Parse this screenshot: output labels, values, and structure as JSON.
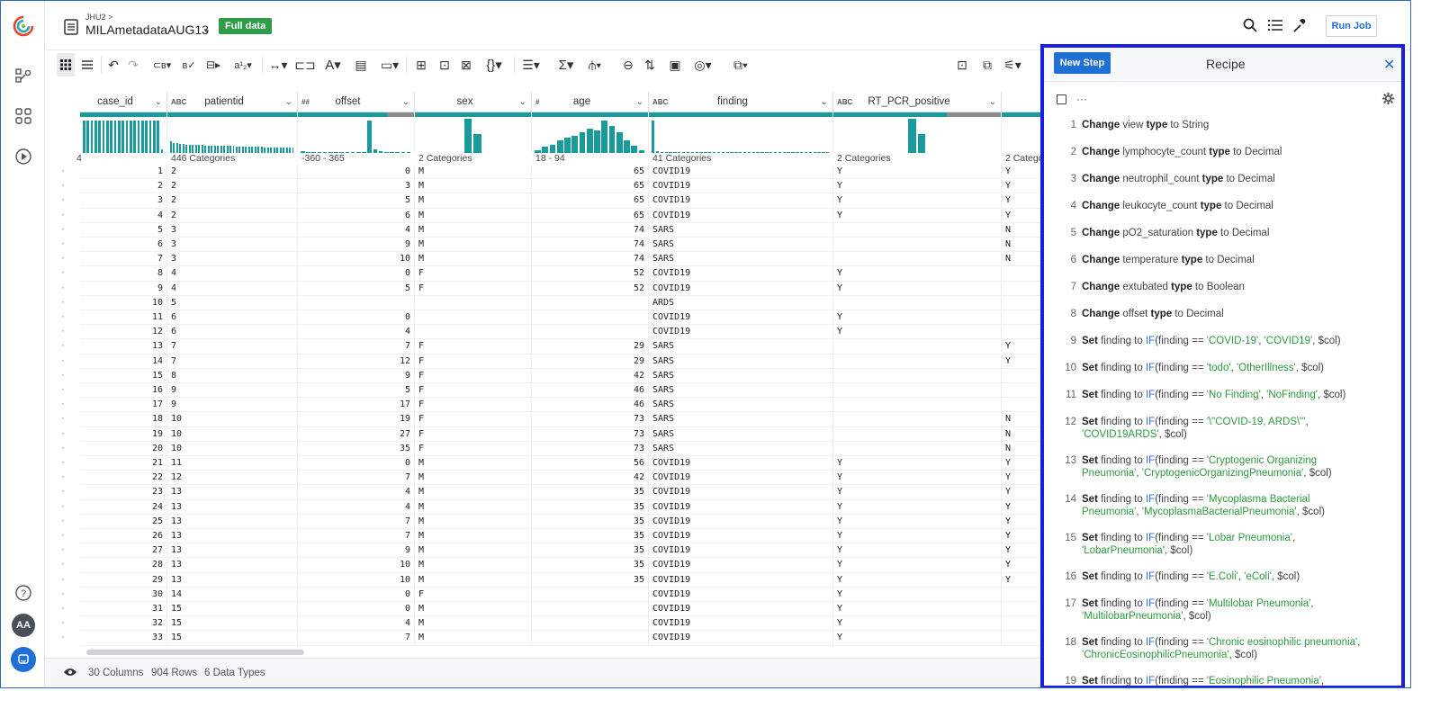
{
  "header": {
    "breadcrumb": "JHU2 >",
    "dataset_name": "MILAmetadataAUG13",
    "full_data_badge": "Full data",
    "run_job_label": "Run Job"
  },
  "colors": {
    "accent": "#1a9a9a",
    "badge": "#2e9d4a",
    "primary": "#1f6fd4",
    "recipe_border": "#1a1ee0"
  },
  "nav": {
    "icons": [
      "logo-icon",
      "flow-icon",
      "library-icon",
      "jobs-icon",
      "help-icon",
      "avatar",
      "chat-icon"
    ],
    "avatar_initials": "AA"
  },
  "toolbar": {
    "icons": [
      "grid-view-icon",
      "list-view-icon",
      "undo-icon",
      "redo-icon",
      "change-type-icon",
      "validate-icon",
      "split-icon",
      "rename-icon",
      "move-column-icon",
      "merge-icon",
      "text-format-icon",
      "extract-icon",
      "restructure-icon",
      "nest-icon",
      "unnest-icon",
      "replace-icon",
      "function-icon",
      "filter-icon",
      "aggregate-icon",
      "pivot-icon",
      "join-icon",
      "sort-icon",
      "comment-icon",
      "target-icon",
      "copy-icon",
      "columns-icon",
      "details-icon",
      "settings-icon"
    ]
  },
  "columns": [
    {
      "name": "case_id",
      "type_label": "",
      "summary": "4"
    },
    {
      "name": "patientid",
      "type_label": "ABC",
      "summary": "446 Categories"
    },
    {
      "name": "offset",
      "type_label": "##",
      "summary": "-360 - 365"
    },
    {
      "name": "sex",
      "type_label": "",
      "summary": "2 Categories"
    },
    {
      "name": "age",
      "type_label": "#",
      "summary": "18 - 94"
    },
    {
      "name": "finding",
      "type_label": "ABC",
      "summary": "41 Categories"
    },
    {
      "name": "RT_PCR_positive",
      "type_label": "ABC",
      "summary": "2 Categories"
    },
    {
      "name": "",
      "type_label": "",
      "summary": "2 Catego"
    }
  ],
  "rows": [
    [
      "1",
      "2",
      "0",
      "M",
      "65",
      "COVID19",
      "Y",
      "Y"
    ],
    [
      "2",
      "2",
      "3",
      "M",
      "65",
      "COVID19",
      "Y",
      "Y"
    ],
    [
      "3",
      "2",
      "5",
      "M",
      "65",
      "COVID19",
      "Y",
      "Y"
    ],
    [
      "4",
      "2",
      "6",
      "M",
      "65",
      "COVID19",
      "Y",
      "Y"
    ],
    [
      "5",
      "3",
      "4",
      "M",
      "74",
      "SARS",
      "",
      "N"
    ],
    [
      "6",
      "3",
      "9",
      "M",
      "74",
      "SARS",
      "",
      "N"
    ],
    [
      "7",
      "3",
      "10",
      "M",
      "74",
      "SARS",
      "",
      "N"
    ],
    [
      "8",
      "4",
      "0",
      "F",
      "52",
      "COVID19",
      "Y",
      ""
    ],
    [
      "9",
      "4",
      "5",
      "F",
      "52",
      "COVID19",
      "Y",
      ""
    ],
    [
      "10",
      "5",
      "",
      "",
      "",
      "ARDS",
      "",
      ""
    ],
    [
      "11",
      "6",
      "0",
      "",
      "",
      "COVID19",
      "Y",
      ""
    ],
    [
      "12",
      "6",
      "4",
      "",
      "",
      "COVID19",
      "Y",
      ""
    ],
    [
      "13",
      "7",
      "7",
      "F",
      "29",
      "SARS",
      "",
      "Y"
    ],
    [
      "14",
      "7",
      "12",
      "F",
      "29",
      "SARS",
      "",
      "Y"
    ],
    [
      "15",
      "8",
      "9",
      "F",
      "42",
      "SARS",
      "",
      ""
    ],
    [
      "16",
      "9",
      "5",
      "F",
      "46",
      "SARS",
      "",
      ""
    ],
    [
      "17",
      "9",
      "17",
      "F",
      "46",
      "SARS",
      "",
      ""
    ],
    [
      "18",
      "10",
      "19",
      "F",
      "73",
      "SARS",
      "",
      "N"
    ],
    [
      "19",
      "10",
      "27",
      "F",
      "73",
      "SARS",
      "",
      "N"
    ],
    [
      "20",
      "10",
      "35",
      "F",
      "73",
      "SARS",
      "",
      "N"
    ],
    [
      "21",
      "11",
      "0",
      "M",
      "56",
      "COVID19",
      "Y",
      "Y"
    ],
    [
      "22",
      "12",
      "7",
      "M",
      "42",
      "COVID19",
      "Y",
      "Y"
    ],
    [
      "23",
      "13",
      "4",
      "M",
      "35",
      "COVID19",
      "Y",
      "Y"
    ],
    [
      "24",
      "13",
      "4",
      "M",
      "35",
      "COVID19",
      "Y",
      "Y"
    ],
    [
      "25",
      "13",
      "7",
      "M",
      "35",
      "COVID19",
      "Y",
      "Y"
    ],
    [
      "26",
      "13",
      "7",
      "M",
      "35",
      "COVID19",
      "Y",
      "Y"
    ],
    [
      "27",
      "13",
      "9",
      "M",
      "35",
      "COVID19",
      "Y",
      "Y"
    ],
    [
      "28",
      "13",
      "10",
      "M",
      "35",
      "COVID19",
      "Y",
      "Y"
    ],
    [
      "29",
      "13",
      "10",
      "M",
      "35",
      "COVID19",
      "Y",
      "Y"
    ],
    [
      "30",
      "14",
      "0",
      "F",
      "",
      "COVID19",
      "Y",
      ""
    ],
    [
      "31",
      "15",
      "0",
      "M",
      "",
      "COVID19",
      "Y",
      ""
    ],
    [
      "32",
      "15",
      "4",
      "M",
      "",
      "COVID19",
      "Y",
      ""
    ],
    [
      "33",
      "15",
      "7",
      "M",
      "",
      "COVID19",
      "Y",
      ""
    ]
  ],
  "histograms": {
    "case_id": [
      0.95,
      0.95,
      0.95,
      0.95,
      0.95,
      0.95,
      0.95,
      0.95,
      0.95,
      0.95,
      0.95,
      0.95,
      0.95,
      0.95,
      0.95,
      0.95,
      0.95,
      0.95,
      0.95,
      0.95,
      0.1
    ],
    "patientid": [
      0.35,
      0.3,
      0.28,
      0.27,
      0.26,
      0.25,
      0.25,
      0.24,
      0.24,
      0.23,
      0.23,
      0.22,
      0.22,
      0.22,
      0.21,
      0.21,
      0.21,
      0.2,
      0.2,
      0.2,
      0.2,
      0.19,
      0.19,
      0.19,
      0.19,
      0.18,
      0.18,
      0.18,
      0.18,
      0.18,
      0.17,
      0.17,
      0.17,
      0.17,
      0.17,
      0.16,
      0.16,
      0.16,
      0.16,
      0.16
    ],
    "offset": [
      0.05,
      0.03,
      0.02,
      0.03,
      0.02,
      0.03,
      0.02,
      0.02,
      0.02,
      0.03,
      0.02,
      0.03,
      0.95,
      0.1,
      0.05,
      0.03,
      0.02,
      0.02,
      0.02,
      0.02
    ],
    "sex": [
      0,
      0,
      0,
      0,
      0,
      1,
      0.55,
      0,
      0,
      0,
      0,
      0
    ],
    "age": [
      0.08,
      0.18,
      0.25,
      0.38,
      0.45,
      0.5,
      0.6,
      0.72,
      0.65,
      0.95,
      0.78,
      0.6,
      0.38,
      0.22,
      0.08
    ],
    "finding": [
      0.95,
      0.04,
      0.03,
      0.02,
      0.02,
      0.02,
      0.02,
      0.02,
      0.02,
      0.02,
      0.02,
      0.02,
      0.02,
      0.02,
      0.02,
      0.02,
      0.02,
      0.02,
      0.02,
      0.02,
      0.02,
      0.02,
      0.02,
      0.02,
      0.02,
      0.02,
      0.02,
      0.02,
      0.02,
      0.02,
      0.02,
      0.02,
      0.02,
      0.02,
      0.02,
      0.02,
      0.02,
      0.02,
      0.02,
      0.02,
      0.02
    ],
    "RT_PCR_positive": [
      0,
      0,
      0,
      0,
      0,
      0,
      0,
      0,
      1,
      0.55,
      0,
      0,
      0,
      0,
      0,
      0,
      0,
      0
    ]
  },
  "footer": {
    "columns_text": "30 Columns",
    "rows_text": "904 Rows",
    "types_text": "6 Data Types"
  },
  "recipe": {
    "title": "Recipe",
    "new_step_label": "New Step",
    "more_label": "···",
    "steps": [
      {
        "num": "1",
        "parts": [
          [
            "kw",
            "Change"
          ],
          [
            "t",
            " view "
          ],
          [
            "kw",
            "type"
          ],
          [
            "t",
            " to String"
          ]
        ]
      },
      {
        "num": "2",
        "parts": [
          [
            "kw",
            "Change"
          ],
          [
            "t",
            " lymphocyte_count "
          ],
          [
            "kw",
            "type"
          ],
          [
            "t",
            " to Decimal"
          ]
        ]
      },
      {
        "num": "3",
        "parts": [
          [
            "kw",
            "Change"
          ],
          [
            "t",
            " neutrophil_count "
          ],
          [
            "kw",
            "type"
          ],
          [
            "t",
            " to Decimal"
          ]
        ]
      },
      {
        "num": "4",
        "parts": [
          [
            "kw",
            "Change"
          ],
          [
            "t",
            " leukocyte_count "
          ],
          [
            "kw",
            "type"
          ],
          [
            "t",
            " to Decimal"
          ]
        ]
      },
      {
        "num": "5",
        "parts": [
          [
            "kw",
            "Change"
          ],
          [
            "t",
            " pO2_saturation "
          ],
          [
            "kw",
            "type"
          ],
          [
            "t",
            " to Decimal"
          ]
        ]
      },
      {
        "num": "6",
        "parts": [
          [
            "kw",
            "Change"
          ],
          [
            "t",
            " temperature "
          ],
          [
            "kw",
            "type"
          ],
          [
            "t",
            " to Decimal"
          ]
        ]
      },
      {
        "num": "7",
        "parts": [
          [
            "kw",
            "Change"
          ],
          [
            "t",
            " extubated "
          ],
          [
            "kw",
            "type"
          ],
          [
            "t",
            " to Boolean"
          ]
        ]
      },
      {
        "num": "8",
        "parts": [
          [
            "kw",
            "Change"
          ],
          [
            "t",
            " offset "
          ],
          [
            "kw",
            "type"
          ],
          [
            "t",
            " to Decimal"
          ]
        ]
      },
      {
        "num": "9",
        "parts": [
          [
            "kw",
            "Set"
          ],
          [
            "t",
            " finding to "
          ],
          [
            "fn",
            "IF"
          ],
          [
            "t",
            "(finding == "
          ],
          [
            "str",
            "'COVID-19'"
          ],
          [
            "t",
            ", "
          ],
          [
            "str",
            "'COVID19'"
          ],
          [
            "t",
            ", $col)"
          ]
        ]
      },
      {
        "num": "10",
        "parts": [
          [
            "kw",
            "Set"
          ],
          [
            "t",
            " finding to "
          ],
          [
            "fn",
            "IF"
          ],
          [
            "t",
            "(finding == "
          ],
          [
            "str",
            "'todo'"
          ],
          [
            "t",
            ", "
          ],
          [
            "str",
            "'OtherIllness'"
          ],
          [
            "t",
            ", $col)"
          ]
        ]
      },
      {
        "num": "11",
        "parts": [
          [
            "kw",
            "Set"
          ],
          [
            "t",
            " finding to "
          ],
          [
            "fn",
            "IF"
          ],
          [
            "t",
            "(finding == "
          ],
          [
            "str",
            "'No Finding'"
          ],
          [
            "t",
            ", "
          ],
          [
            "str",
            "'NoFinding'"
          ],
          [
            "t",
            ", $col)"
          ]
        ]
      },
      {
        "num": "12",
        "parts": [
          [
            "kw",
            "Set"
          ],
          [
            "t",
            " finding to "
          ],
          [
            "fn",
            "IF"
          ],
          [
            "t",
            "(finding == "
          ],
          [
            "str",
            "'\\\"COVID-19, ARDS\\\"'"
          ],
          [
            "t",
            ", "
          ],
          [
            "str",
            "'COVID19ARDS'"
          ],
          [
            "t",
            ", $col)"
          ]
        ]
      },
      {
        "num": "13",
        "parts": [
          [
            "kw",
            "Set"
          ],
          [
            "t",
            " finding to "
          ],
          [
            "fn",
            "IF"
          ],
          [
            "t",
            "(finding == "
          ],
          [
            "str",
            "'Cryptogenic Organizing Pneumonia'"
          ],
          [
            "t",
            ", "
          ],
          [
            "str",
            "'CryptogenicOrganizingPneumonia'"
          ],
          [
            "t",
            ", $col)"
          ]
        ]
      },
      {
        "num": "14",
        "parts": [
          [
            "kw",
            "Set"
          ],
          [
            "t",
            " finding to "
          ],
          [
            "fn",
            "IF"
          ],
          [
            "t",
            "(finding == "
          ],
          [
            "str",
            "'Mycoplasma Bacterial Pneumonia'"
          ],
          [
            "t",
            ", "
          ],
          [
            "str",
            "'MycoplasmaBacterialPneumonia'"
          ],
          [
            "t",
            ", $col)"
          ]
        ]
      },
      {
        "num": "15",
        "parts": [
          [
            "kw",
            "Set"
          ],
          [
            "t",
            " finding to "
          ],
          [
            "fn",
            "IF"
          ],
          [
            "t",
            "(finding == "
          ],
          [
            "str",
            "'Lobar Pneumonia'"
          ],
          [
            "t",
            ", "
          ],
          [
            "str",
            "'LobarPneumonia'"
          ],
          [
            "t",
            ", $col)"
          ]
        ]
      },
      {
        "num": "16",
        "parts": [
          [
            "kw",
            "Set"
          ],
          [
            "t",
            " finding to "
          ],
          [
            "fn",
            "IF"
          ],
          [
            "t",
            "(finding == "
          ],
          [
            "str",
            "'E.Coli'"
          ],
          [
            "t",
            ", "
          ],
          [
            "str",
            "'eColi'"
          ],
          [
            "t",
            ", $col)"
          ]
        ]
      },
      {
        "num": "17",
        "parts": [
          [
            "kw",
            "Set"
          ],
          [
            "t",
            " finding to "
          ],
          [
            "fn",
            "IF"
          ],
          [
            "t",
            "(finding == "
          ],
          [
            "str",
            "'Multilobar Pneumonia'"
          ],
          [
            "t",
            ", "
          ],
          [
            "str",
            "'MultilobarPneumonia'"
          ],
          [
            "t",
            ", $col)"
          ]
        ]
      },
      {
        "num": "18",
        "parts": [
          [
            "kw",
            "Set"
          ],
          [
            "t",
            " finding to "
          ],
          [
            "fn",
            "IF"
          ],
          [
            "t",
            "(finding == "
          ],
          [
            "str",
            "'Chronic eosinophilic pneumonia'"
          ],
          [
            "t",
            ", "
          ],
          [
            "str",
            "'ChronicEosinophilicPneumonia'"
          ],
          [
            "t",
            ", $col)"
          ]
        ]
      },
      {
        "num": "19",
        "parts": [
          [
            "kw",
            "Set"
          ],
          [
            "t",
            " finding to "
          ],
          [
            "fn",
            "IF"
          ],
          [
            "t",
            "(finding == "
          ],
          [
            "str",
            "'Eosinophilic Pneumonia'"
          ],
          [
            "t",
            ","
          ]
        ]
      }
    ]
  }
}
